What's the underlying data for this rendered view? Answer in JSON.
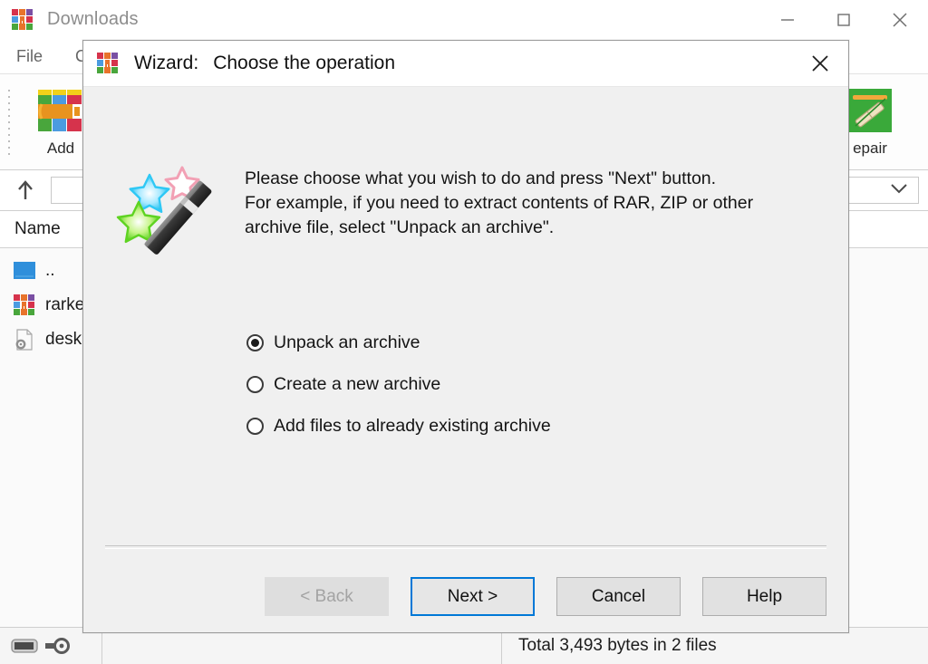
{
  "main_window": {
    "title": "Downloads",
    "app_icon": "winrar-books-icon",
    "window_controls": [
      {
        "name": "minimize-button",
        "glyph": "minimize-icon"
      },
      {
        "name": "maximize-button",
        "glyph": "maximize-icon"
      },
      {
        "name": "close-button",
        "glyph": "close-icon"
      }
    ],
    "menu": [
      {
        "label": "File"
      },
      {
        "label": "C"
      }
    ],
    "toolbar": [
      {
        "label": "Add",
        "icon": "add-archive-icon"
      },
      {
        "label": "epair",
        "icon": "repair-archive-icon"
      }
    ],
    "address_bar": {
      "up_icon": "up-arrow-icon",
      "dropdown_icon": "chevron-down-icon",
      "value": ""
    },
    "file_list": {
      "columns": [
        "Name"
      ],
      "rows": [
        {
          "name": "..",
          "icon": "parent-folder-icon"
        },
        {
          "name": "rarke",
          "icon": "rar-archive-icon"
        },
        {
          "name": "desk",
          "icon": "config-file-icon"
        }
      ]
    },
    "status_bar": {
      "icons": [
        "disk-indicator-icon",
        "key-icon"
      ],
      "total_text": "Total 3,493 bytes in 2 files"
    }
  },
  "dialog": {
    "icon": "winrar-books-icon",
    "title_prefix": "Wizard:",
    "title_text": "Choose the operation",
    "close_icon": "close-icon",
    "wand_icon": "magic-wand-icon",
    "instructions": [
      "Please choose what you wish to do and press \"Next\" button.",
      "For example, if you need to extract contents of RAR, ZIP or other",
      "archive file, select \"Unpack an archive\"."
    ],
    "options": [
      {
        "label": "Unpack an archive",
        "checked": true
      },
      {
        "label": "Create a new archive",
        "checked": false
      },
      {
        "label": "Add files to already existing archive",
        "checked": false
      }
    ],
    "buttons": [
      {
        "label": "< Back",
        "state": "disabled",
        "name": "back-button"
      },
      {
        "label": "Next >",
        "state": "default",
        "name": "next-button"
      },
      {
        "label": "Cancel",
        "state": "normal",
        "name": "cancel-button"
      },
      {
        "label": "Help",
        "state": "normal",
        "name": "help-button"
      }
    ]
  },
  "colors": {
    "accent": "#0078d7",
    "dialog_bg": "#f0f0f0",
    "text": "#141414",
    "disabled_text": "#a3a3a3",
    "title_gray": "#8d8d8d"
  }
}
